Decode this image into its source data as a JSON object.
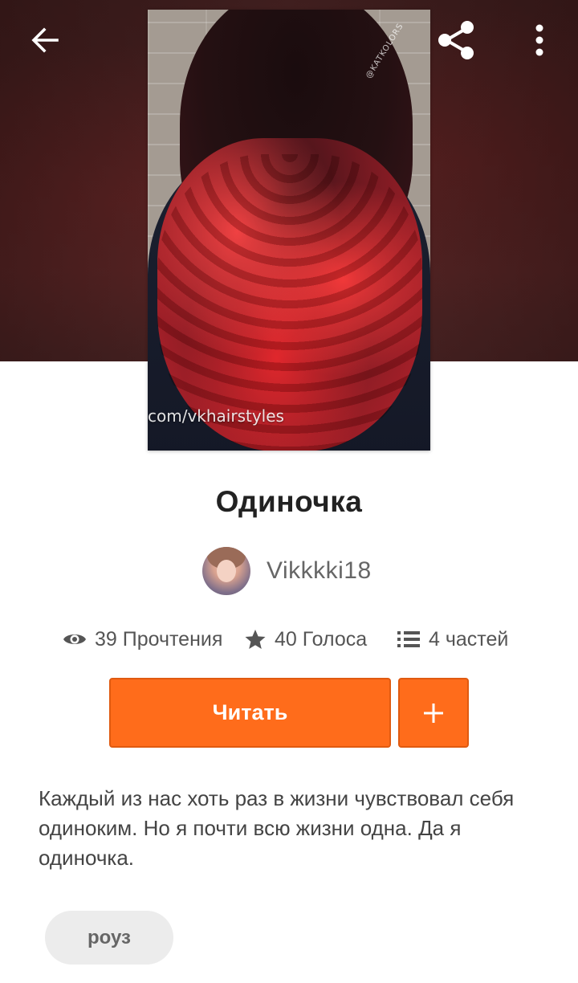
{
  "topbar": {
    "back_icon": "arrow-left-icon",
    "share_icon": "share-icon",
    "more_icon": "more-vertical-icon"
  },
  "cover": {
    "watermark_bottom": "com/vkhairstyles",
    "watermark_top": "@KATKOLORS"
  },
  "story": {
    "title": "Одиночка",
    "author": "Vikkkki18",
    "stats": {
      "reads": "39 Прочтения",
      "votes": "40 Голоса",
      "parts": "4 частей"
    },
    "description": "Каждый из нас хоть раз в жизни чувствовал себя одиноким. Но я почти всю жизни одна. Да я одиночка.",
    "tags": [
      "роуз"
    ]
  },
  "actions": {
    "read_label": "Читать",
    "add_label": "+"
  },
  "colors": {
    "accent": "#ff6c1b",
    "text_primary": "#222222",
    "text_secondary": "#555555",
    "tag_bg": "#ececec"
  }
}
